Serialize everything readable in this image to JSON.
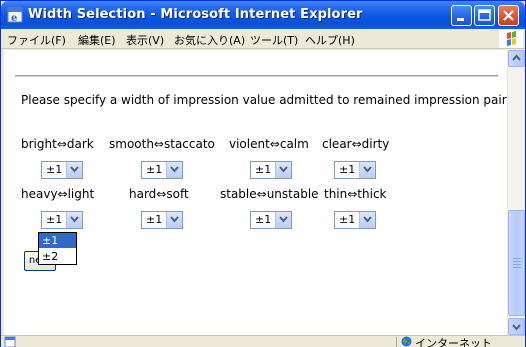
{
  "window": {
    "title": "Width Selection - Microsoft Internet Explorer"
  },
  "menu": {
    "items": [
      "ファイル(F)",
      "編集(E)",
      "表示(V)",
      "お気に入り(A)",
      "ツール(T)",
      "ヘルプ(H)"
    ]
  },
  "page": {
    "instruction": "Please specify a width of impression value admitted to remained impression pairs.",
    "pairs": [
      {
        "label": "bright⇔dark",
        "value": "±1"
      },
      {
        "label": "smooth⇔staccato",
        "value": "±1"
      },
      {
        "label": "violent⇔calm",
        "value": "±1"
      },
      {
        "label": "clear⇔dirty",
        "value": "±1"
      },
      {
        "label": "heavy⇔light",
        "value": "±1"
      },
      {
        "label": "hard⇔soft",
        "value": "±1"
      },
      {
        "label": "stable⇔unstable",
        "value": "±1"
      },
      {
        "label": "thin⇔thick",
        "value": "±1"
      }
    ],
    "open_dropdown": {
      "options": [
        "±1",
        "±2"
      ],
      "highlighted": "±1"
    },
    "next_label": "next"
  },
  "status": {
    "zone": "インターネット"
  },
  "colors": {
    "titlebar": "#0b58e2",
    "selection": "#316ac5",
    "select_border": "#7f9db9"
  }
}
